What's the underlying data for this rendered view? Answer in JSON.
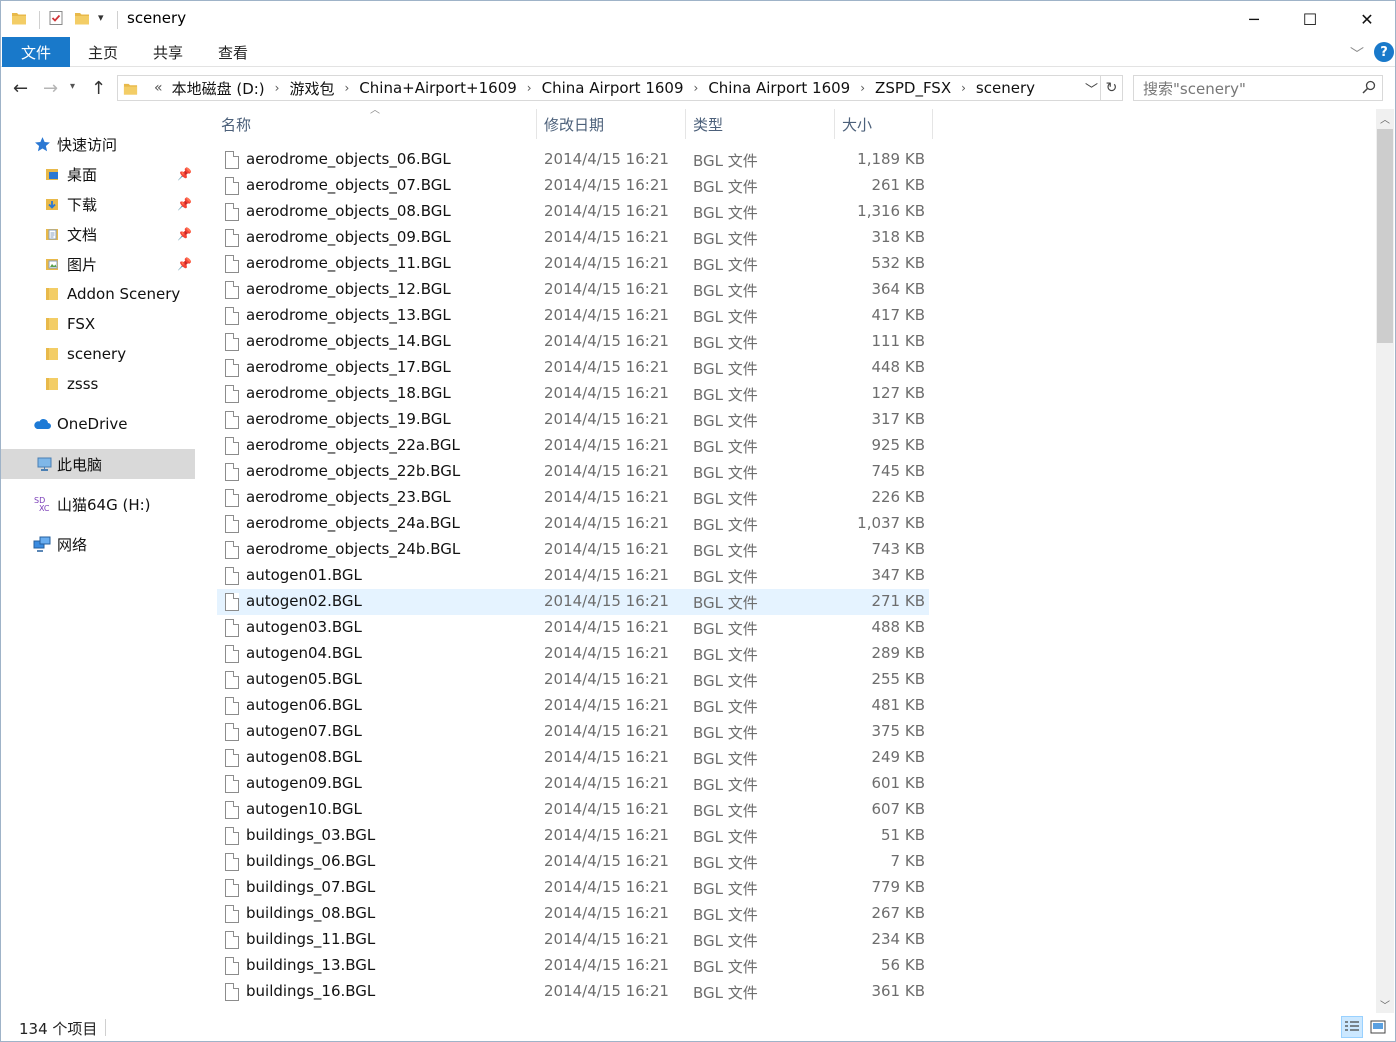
{
  "window": {
    "title": "scenery",
    "controls": {
      "minimize": "─",
      "maximize": "☐",
      "close": "✕"
    }
  },
  "ribbon": {
    "tabs": [
      {
        "label": "文件"
      },
      {
        "label": "主页"
      },
      {
        "label": "共享"
      },
      {
        "label": "查看"
      }
    ]
  },
  "address_bar": {
    "overflow": "«",
    "path": [
      "本地磁盘 (D:)",
      "游戏包",
      "China+Airport+1609",
      "China Airport 1609",
      "China Airport 1609",
      "ZSPD_FSX",
      "scenery"
    ]
  },
  "search": {
    "placeholder": "搜索\"scenery\""
  },
  "sidebar": {
    "quick_access": "快速访问",
    "pinned": [
      {
        "label": "桌面",
        "icon": "desktop-folder-icon"
      },
      {
        "label": "下载",
        "icon": "download-folder-icon"
      },
      {
        "label": "文档",
        "icon": "documents-folder-icon"
      },
      {
        "label": "图片",
        "icon": "pictures-folder-icon"
      }
    ],
    "recent": [
      {
        "label": "Addon Scenery"
      },
      {
        "label": "FSX"
      },
      {
        "label": "scenery"
      },
      {
        "label": "zsss"
      }
    ],
    "onedrive": "OneDrive",
    "this_pc": "此电脑",
    "drive": "山猫64G (H:)",
    "network": "网络"
  },
  "columns": {
    "name": "名称",
    "modified": "修改日期",
    "type": "类型",
    "size": "大小"
  },
  "files": [
    {
      "name": "aerodrome_objects_06.BGL",
      "modified": "2014/4/15 16:21",
      "type": "BGL 文件",
      "size": "1,189 KB"
    },
    {
      "name": "aerodrome_objects_07.BGL",
      "modified": "2014/4/15 16:21",
      "type": "BGL 文件",
      "size": "261 KB"
    },
    {
      "name": "aerodrome_objects_08.BGL",
      "modified": "2014/4/15 16:21",
      "type": "BGL 文件",
      "size": "1,316 KB"
    },
    {
      "name": "aerodrome_objects_09.BGL",
      "modified": "2014/4/15 16:21",
      "type": "BGL 文件",
      "size": "318 KB"
    },
    {
      "name": "aerodrome_objects_11.BGL",
      "modified": "2014/4/15 16:21",
      "type": "BGL 文件",
      "size": "532 KB"
    },
    {
      "name": "aerodrome_objects_12.BGL",
      "modified": "2014/4/15 16:21",
      "type": "BGL 文件",
      "size": "364 KB"
    },
    {
      "name": "aerodrome_objects_13.BGL",
      "modified": "2014/4/15 16:21",
      "type": "BGL 文件",
      "size": "417 KB"
    },
    {
      "name": "aerodrome_objects_14.BGL",
      "modified": "2014/4/15 16:21",
      "type": "BGL 文件",
      "size": "111 KB"
    },
    {
      "name": "aerodrome_objects_17.BGL",
      "modified": "2014/4/15 16:21",
      "type": "BGL 文件",
      "size": "448 KB"
    },
    {
      "name": "aerodrome_objects_18.BGL",
      "modified": "2014/4/15 16:21",
      "type": "BGL 文件",
      "size": "127 KB"
    },
    {
      "name": "aerodrome_objects_19.BGL",
      "modified": "2014/4/15 16:21",
      "type": "BGL 文件",
      "size": "317 KB"
    },
    {
      "name": "aerodrome_objects_22a.BGL",
      "modified": "2014/4/15 16:21",
      "type": "BGL 文件",
      "size": "925 KB"
    },
    {
      "name": "aerodrome_objects_22b.BGL",
      "modified": "2014/4/15 16:21",
      "type": "BGL 文件",
      "size": "745 KB"
    },
    {
      "name": "aerodrome_objects_23.BGL",
      "modified": "2014/4/15 16:21",
      "type": "BGL 文件",
      "size": "226 KB"
    },
    {
      "name": "aerodrome_objects_24a.BGL",
      "modified": "2014/4/15 16:21",
      "type": "BGL 文件",
      "size": "1,037 KB"
    },
    {
      "name": "aerodrome_objects_24b.BGL",
      "modified": "2014/4/15 16:21",
      "type": "BGL 文件",
      "size": "743 KB"
    },
    {
      "name": "autogen01.BGL",
      "modified": "2014/4/15 16:21",
      "type": "BGL 文件",
      "size": "347 KB"
    },
    {
      "name": "autogen02.BGL",
      "modified": "2014/4/15 16:21",
      "type": "BGL 文件",
      "size": "271 KB",
      "hover": true
    },
    {
      "name": "autogen03.BGL",
      "modified": "2014/4/15 16:21",
      "type": "BGL 文件",
      "size": "488 KB"
    },
    {
      "name": "autogen04.BGL",
      "modified": "2014/4/15 16:21",
      "type": "BGL 文件",
      "size": "289 KB"
    },
    {
      "name": "autogen05.BGL",
      "modified": "2014/4/15 16:21",
      "type": "BGL 文件",
      "size": "255 KB"
    },
    {
      "name": "autogen06.BGL",
      "modified": "2014/4/15 16:21",
      "type": "BGL 文件",
      "size": "481 KB"
    },
    {
      "name": "autogen07.BGL",
      "modified": "2014/4/15 16:21",
      "type": "BGL 文件",
      "size": "375 KB"
    },
    {
      "name": "autogen08.BGL",
      "modified": "2014/4/15 16:21",
      "type": "BGL 文件",
      "size": "249 KB"
    },
    {
      "name": "autogen09.BGL",
      "modified": "2014/4/15 16:21",
      "type": "BGL 文件",
      "size": "601 KB"
    },
    {
      "name": "autogen10.BGL",
      "modified": "2014/4/15 16:21",
      "type": "BGL 文件",
      "size": "607 KB"
    },
    {
      "name": "buildings_03.BGL",
      "modified": "2014/4/15 16:21",
      "type": "BGL 文件",
      "size": "51 KB"
    },
    {
      "name": "buildings_06.BGL",
      "modified": "2014/4/15 16:21",
      "type": "BGL 文件",
      "size": "7 KB"
    },
    {
      "name": "buildings_07.BGL",
      "modified": "2014/4/15 16:21",
      "type": "BGL 文件",
      "size": "779 KB"
    },
    {
      "name": "buildings_08.BGL",
      "modified": "2014/4/15 16:21",
      "type": "BGL 文件",
      "size": "267 KB"
    },
    {
      "name": "buildings_11.BGL",
      "modified": "2014/4/15 16:21",
      "type": "BGL 文件",
      "size": "234 KB"
    },
    {
      "name": "buildings_13.BGL",
      "modified": "2014/4/15 16:21",
      "type": "BGL 文件",
      "size": "56 KB"
    },
    {
      "name": "buildings_16.BGL",
      "modified": "2014/4/15 16:21",
      "type": "BGL 文件",
      "size": "361 KB"
    }
  ],
  "status": {
    "item_count": "134 个项目"
  },
  "colors": {
    "accent": "#1979ca",
    "hover_row": "#e5f3ff",
    "selected_nav": "#d9d9d9",
    "folder": "#e8b94a",
    "header_text": "#4c607a"
  }
}
